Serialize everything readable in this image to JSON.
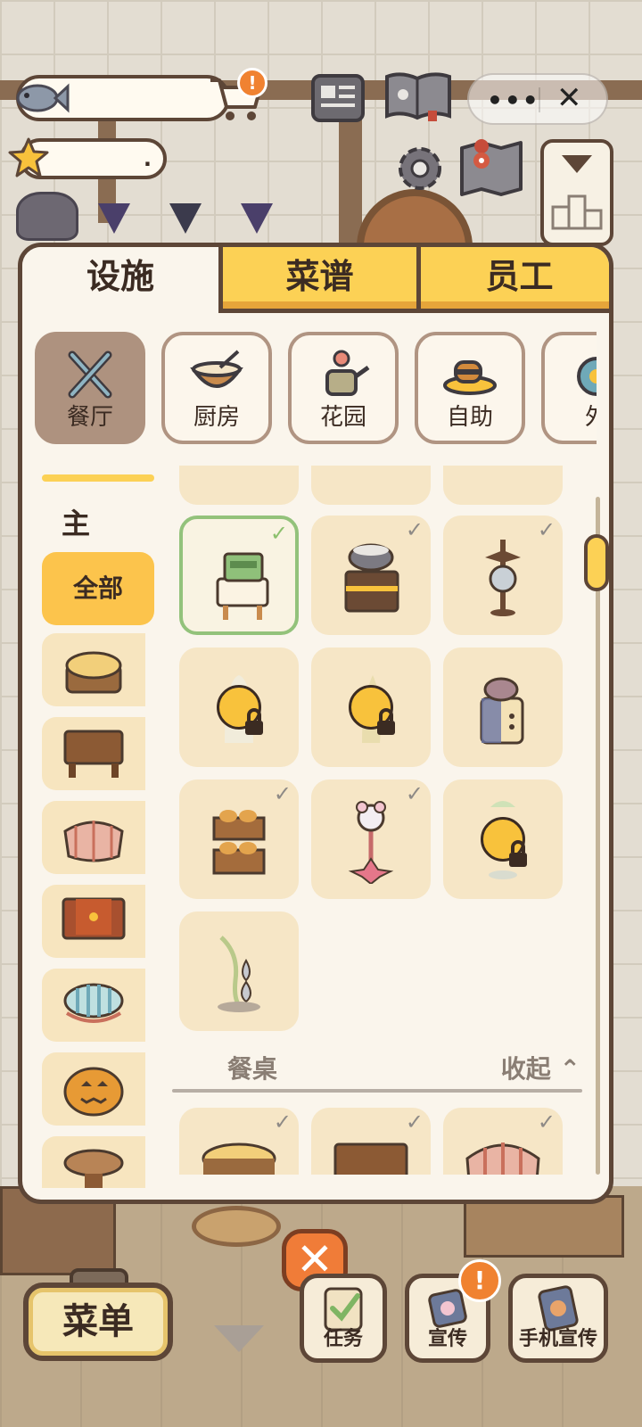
{
  "hud": {
    "star_value": "."
  },
  "window_controls": {
    "more": "•••",
    "close": "✕"
  },
  "tabs": [
    {
      "label": "设施",
      "active": true
    },
    {
      "label": "菜谱",
      "active": false
    },
    {
      "label": "员工",
      "active": false
    }
  ],
  "categories": [
    {
      "label": "餐厅",
      "icon": "utensils-icon",
      "active": true
    },
    {
      "label": "厨房",
      "icon": "mixing-bowl-icon",
      "active": false
    },
    {
      "label": "花园",
      "icon": "watering-can-icon",
      "active": false
    },
    {
      "label": "自助",
      "icon": "buffet-food-icon",
      "active": false
    },
    {
      "label": "外",
      "icon": "outdoor-icon",
      "active": false
    }
  ],
  "sidebar": {
    "heading": "主",
    "all_label": "全部",
    "items": [
      "stump-table-icon",
      "wood-table-icon",
      "checkered-table-icon",
      "red-cloth-table-icon",
      "striped-table-icon",
      "pumpkin-table-icon",
      "round-stool-table-icon"
    ]
  },
  "grid": {
    "items": [
      {
        "name": "cash-register",
        "state": "selected"
      },
      {
        "name": "cauldron-cart",
        "state": "owned"
      },
      {
        "name": "bat-lamp",
        "state": "owned"
      },
      {
        "name": "ghost-decor",
        "state": "locked"
      },
      {
        "name": "smoke-fountain",
        "state": "locked"
      },
      {
        "name": "cat-stove",
        "state": "available"
      },
      {
        "name": "bread-shelf",
        "state": "owned"
      },
      {
        "name": "mouse-star-lamp",
        "state": "owned"
      },
      {
        "name": "plant-decor",
        "state": "locked"
      },
      {
        "name": "water-drop-fountain",
        "state": "available"
      }
    ],
    "section": {
      "title": "餐桌",
      "toggle": "收起 ⌃"
    },
    "check_mark": "✓"
  },
  "bottom": {
    "close_glyph": "✕",
    "menu_label": "菜单",
    "buttons": [
      {
        "label": "任务"
      },
      {
        "label": "宣传"
      },
      {
        "label": "手机宣传"
      }
    ],
    "alert_glyph": "!"
  },
  "colors": {
    "panel_border": "#5d4637",
    "tab_inactive": "#fcd155",
    "selected_tile_border": "#93c27b",
    "close_button": "#f07c38"
  }
}
